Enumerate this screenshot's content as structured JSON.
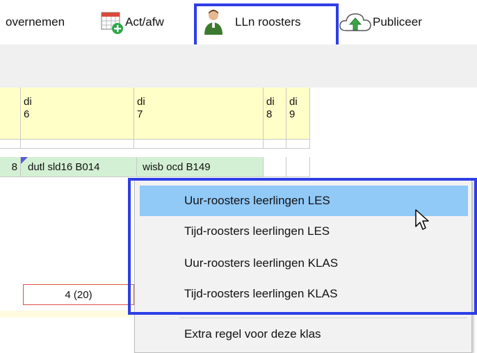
{
  "toolbar": {
    "overnemen_label": "overnemen",
    "actafw_label": "Act/afw",
    "llnroosters_label": "LLn roosters",
    "publiceer_label": "Publiceer"
  },
  "grid": {
    "headers": [
      {
        "day": "di",
        "num": "6"
      },
      {
        "day": "di",
        "num": "7"
      },
      {
        "day": "di",
        "num": "8"
      },
      {
        "day": "di",
        "num": "9"
      }
    ],
    "row": {
      "lead": "8",
      "cell1": "dutl sld16 B014",
      "cell2": "wisb ocd B149"
    },
    "count": "4 (20)"
  },
  "context_menu": {
    "items": [
      "Uur-roosters leerlingen LES",
      "Tijd-roosters leerlingen LES",
      "Uur-roosters leerlingen KLAS",
      "Tijd-roosters leerlingen KLAS",
      "Extra regel voor deze klas"
    ],
    "selected_index": 0
  },
  "colors": {
    "highlight": "#2e3ee6",
    "header_bg": "#ffffc8",
    "row_bg": "#d4f0d4",
    "menu_selected": "#91c9f7"
  }
}
